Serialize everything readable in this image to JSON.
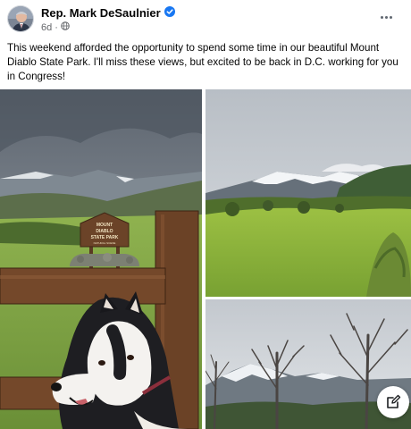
{
  "post": {
    "author": "Rep. Mark DeSaulnier",
    "time": "6d",
    "verified_icon": "verified-badge-icon",
    "privacy_icon": "globe-icon",
    "text": "This weekend afforded the opportunity to spend some time in our beautiful Mount Diablo State Park. I'll miss these views, but excited to be back in D.C. working for you in Congress!"
  },
  "photos": {
    "sign": {
      "line1": "MOUNT",
      "line2": "DIABLO",
      "line3": "STATE PARK",
      "line4": "NATURAL SCENE"
    }
  },
  "icons": {
    "more": "more-options-icon",
    "compose": "compose-icon"
  },
  "colors": {
    "text": "#050505",
    "meta": "#65676b",
    "verified": "#1877f2"
  }
}
